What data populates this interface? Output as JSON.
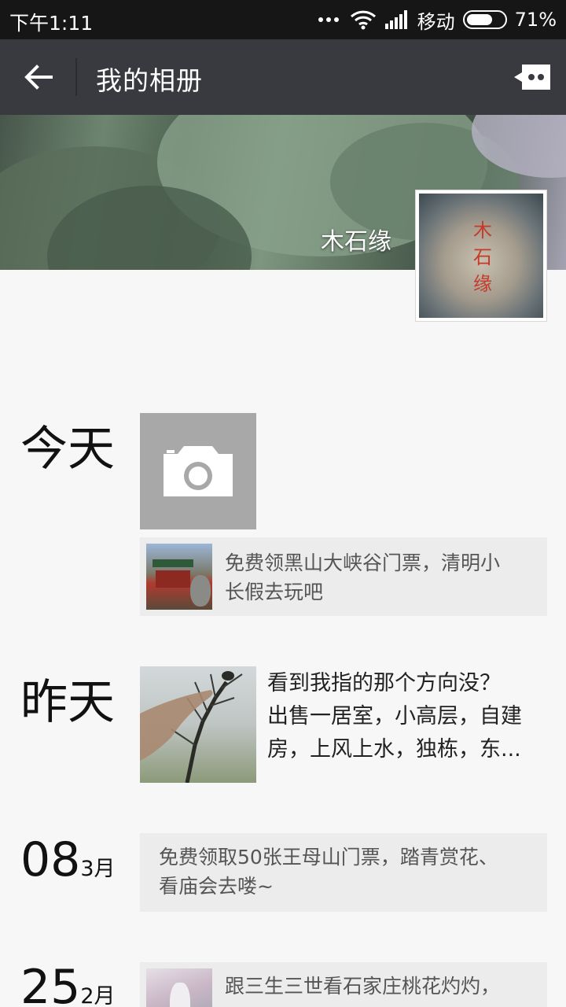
{
  "status_bar": {
    "time": "下午1:11",
    "carrier": "移动",
    "battery": "71%",
    "battery_level": 0.71
  },
  "title_bar": {
    "title": "我的相册"
  },
  "profile": {
    "nickname": "木石缘",
    "avatar_seal_text": "木石缘"
  },
  "timeline": {
    "today": {
      "label": "今天",
      "share": {
        "text_line1": "免费领黑山大峡谷门票，清明小",
        "text_line2": "长假去玩吧"
      }
    },
    "yesterday": {
      "label": "昨天",
      "post": {
        "line1": "看到我指的那个方向没？",
        "line2": "出售一居室，小高层，自建",
        "line3": "房，上风上水，独栋，东..."
      }
    },
    "entry_0803": {
      "day": "08",
      "month": "3月",
      "share": {
        "text_line1": "免费领取50张王母山门票，踏青赏花、",
        "text_line2": "看庙会去喽~"
      }
    },
    "entry_2502": {
      "day": "25",
      "month": "2月",
      "share": {
        "text_line1": "跟三生三世看石家庄桃花灼灼，"
      }
    }
  }
}
